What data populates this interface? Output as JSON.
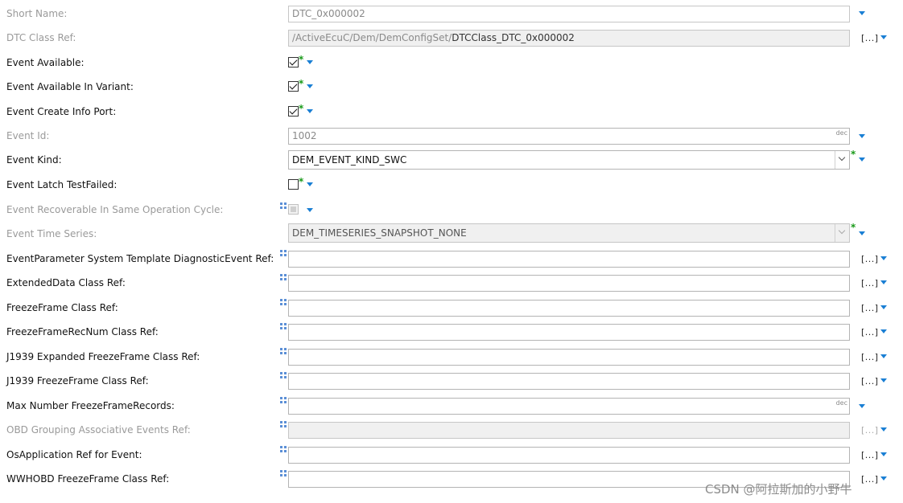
{
  "colors": {
    "accent": "#1a7fd4",
    "modified_star": "#1a9a1a",
    "disabled_text": "#9a9a9a"
  },
  "icons": {
    "dropdown": "triangle-down-icon",
    "modified": "green-star-icon",
    "multiplicity": "tree-nodes-icon"
  },
  "fields": {
    "short_name": {
      "label": "Short Name:",
      "value": "DTC_0x000002"
    },
    "dtc_class_ref": {
      "label": "DTC Class Ref:",
      "value_path": "/ActiveEcuC/Dem/DemConfigSet/",
      "value_name": "DTCClass_DTC_0x000002",
      "browse": "[...]"
    },
    "event_available": {
      "label": "Event Available:",
      "modified": "*"
    },
    "event_available_in_variant": {
      "label": "Event Available In Variant:",
      "modified": "*"
    },
    "event_create_info_port": {
      "label": "Event Create Info Port:",
      "modified": "*"
    },
    "event_id": {
      "label": "Event Id:",
      "value": "1002",
      "format": "dec"
    },
    "event_kind": {
      "label": "Event Kind:",
      "value": "DEM_EVENT_KIND_SWC",
      "modified": "*"
    },
    "event_latch_test_failed": {
      "label": "Event Latch TestFailed:",
      "modified": "*"
    },
    "event_recoverable": {
      "label": "Event Recoverable In Same Operation Cycle:"
    },
    "event_time_series": {
      "label": "Event Time Series:",
      "value": "DEM_TIMESERIES_SNAPSHOT_NONE",
      "modified": "*"
    },
    "event_param_ref": {
      "label": "EventParameter System Template DiagnosticEvent Ref:",
      "value": "",
      "browse": "[...]"
    },
    "extended_data_ref": {
      "label": "ExtendedData Class Ref:",
      "value": "",
      "browse": "[...]"
    },
    "freeze_frame_ref": {
      "label": "FreezeFrame Class Ref:",
      "value": "",
      "browse": "[...]"
    },
    "freeze_frame_recnum_ref": {
      "label": "FreezeFrameRecNum Class Ref:",
      "value": "",
      "browse": "[...]"
    },
    "j1939_expanded_ref": {
      "label": "J1939 Expanded FreezeFrame Class Ref:",
      "value": "",
      "browse": "[...]"
    },
    "j1939_freeze_ref": {
      "label": "J1939 FreezeFrame Class Ref:",
      "value": "",
      "browse": "[...]"
    },
    "max_freeze_records": {
      "label": "Max Number FreezeFrameRecords:",
      "value": "",
      "format": "dec"
    },
    "obd_grouping_ref": {
      "label": "OBD Grouping Associative Events Ref:",
      "value": "",
      "browse": "[...]"
    },
    "os_app_ref": {
      "label": "OsApplication Ref for Event:",
      "value": "",
      "browse": "[...]"
    },
    "wwhobd_freeze_ref": {
      "label": "WWHOBD FreezeFrame Class Ref:",
      "value": "",
      "browse": "[...]"
    }
  },
  "watermark": "CSDN @阿拉斯加的小野牛"
}
